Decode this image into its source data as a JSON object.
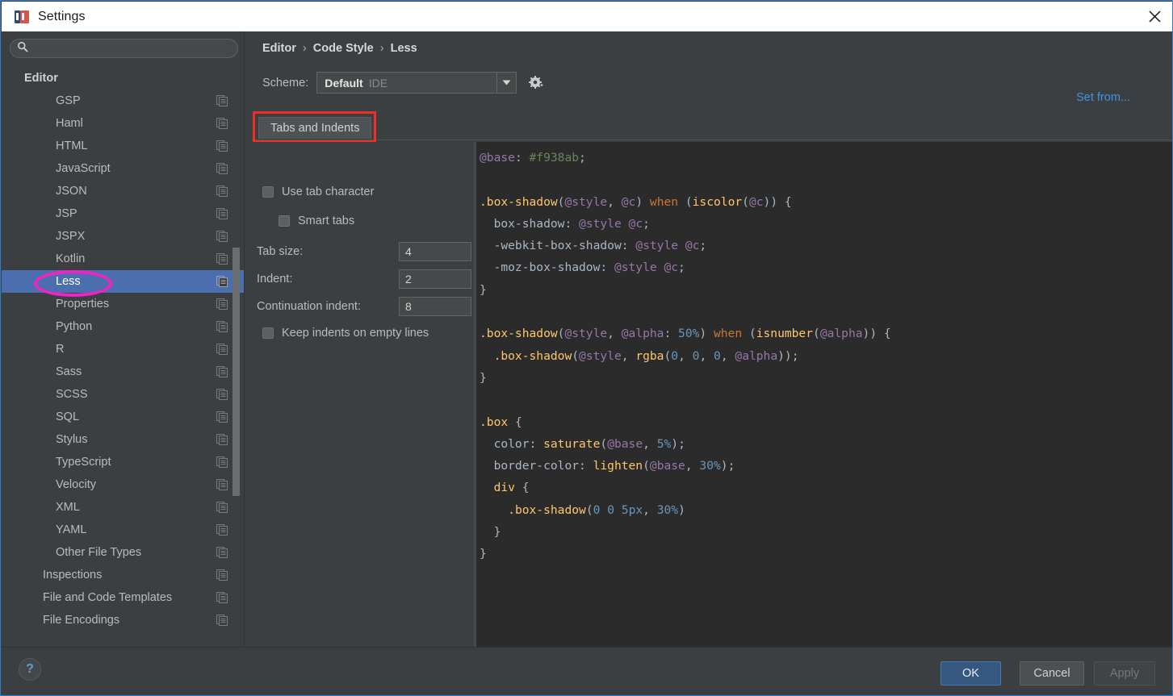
{
  "window": {
    "title": "Settings",
    "app_icon": "intellij-idea-icon",
    "close_icon": "close-icon"
  },
  "sidebar": {
    "search": {
      "value": "",
      "placeholder": "",
      "icon": "search-icon"
    },
    "items": [
      {
        "label": "Editor",
        "level": 0,
        "selected": false,
        "copy_icon": false
      },
      {
        "label": "GSP",
        "level": 2,
        "selected": false,
        "copy_icon": true
      },
      {
        "label": "Haml",
        "level": 2,
        "selected": false,
        "copy_icon": true
      },
      {
        "label": "HTML",
        "level": 2,
        "selected": false,
        "copy_icon": true
      },
      {
        "label": "JavaScript",
        "level": 2,
        "selected": false,
        "copy_icon": true
      },
      {
        "label": "JSON",
        "level": 2,
        "selected": false,
        "copy_icon": true
      },
      {
        "label": "JSP",
        "level": 2,
        "selected": false,
        "copy_icon": true
      },
      {
        "label": "JSPX",
        "level": 2,
        "selected": false,
        "copy_icon": true
      },
      {
        "label": "Kotlin",
        "level": 2,
        "selected": false,
        "copy_icon": true
      },
      {
        "label": "Less",
        "level": 2,
        "selected": true,
        "copy_icon": true
      },
      {
        "label": "Properties",
        "level": 2,
        "selected": false,
        "copy_icon": true
      },
      {
        "label": "Python",
        "level": 2,
        "selected": false,
        "copy_icon": true
      },
      {
        "label": "R",
        "level": 2,
        "selected": false,
        "copy_icon": true
      },
      {
        "label": "Sass",
        "level": 2,
        "selected": false,
        "copy_icon": true
      },
      {
        "label": "SCSS",
        "level": 2,
        "selected": false,
        "copy_icon": true
      },
      {
        "label": "SQL",
        "level": 2,
        "selected": false,
        "copy_icon": true
      },
      {
        "label": "Stylus",
        "level": 2,
        "selected": false,
        "copy_icon": true
      },
      {
        "label": "TypeScript",
        "level": 2,
        "selected": false,
        "copy_icon": true
      },
      {
        "label": "Velocity",
        "level": 2,
        "selected": false,
        "copy_icon": true
      },
      {
        "label": "XML",
        "level": 2,
        "selected": false,
        "copy_icon": true
      },
      {
        "label": "YAML",
        "level": 2,
        "selected": false,
        "copy_icon": true
      },
      {
        "label": "Other File Types",
        "level": 2,
        "selected": false,
        "copy_icon": true
      },
      {
        "label": "Inspections",
        "level": 1,
        "selected": false,
        "copy_icon": true
      },
      {
        "label": "File and Code Templates",
        "level": 1,
        "selected": false,
        "copy_icon": true
      },
      {
        "label": "File Encodings",
        "level": 1,
        "selected": false,
        "copy_icon": true
      }
    ]
  },
  "breadcrumb": {
    "part1": "Editor",
    "part2": "Code Style",
    "part3": "Less",
    "separator": "›"
  },
  "scheme": {
    "label": "Scheme:",
    "value": "Default",
    "scope": "IDE",
    "dropdown_icon": "chevron-down-icon",
    "gear_icon": "gear-icon"
  },
  "set_from_link": "Set from...",
  "tabs": [
    {
      "label": "Tabs and Indents",
      "active": true,
      "annotated": true
    }
  ],
  "options": {
    "use_tab_character": {
      "label": "Use tab character",
      "checked": false
    },
    "smart_tabs": {
      "label": "Smart tabs",
      "checked": false
    },
    "tab_size": {
      "label": "Tab size:",
      "value": "4"
    },
    "indent": {
      "label": "Indent:",
      "value": "2"
    },
    "continuation_indent": {
      "label": "Continuation indent:",
      "value": "8"
    },
    "keep_indents": {
      "label": "Keep indents on empty lines",
      "checked": false
    }
  },
  "preview_code": {
    "language": "Less",
    "lines": [
      "@base: #f938ab;",
      "",
      ".box-shadow(@style, @c) when (iscolor(@c)) {",
      "  box-shadow: @style @c;",
      "  -webkit-box-shadow: @style @c;",
      "  -moz-box-shadow: @style @c;",
      "}",
      "",
      ".box-shadow(@style, @alpha: 50%) when (isnumber(@alpha)) {",
      "  .box-shadow(@style, rgba(0, 0, 0, @alpha));",
      "}",
      "",
      ".box {",
      "  color: saturate(@base, 5%);",
      "  border-color: lighten(@base, 30%);",
      "  div {",
      "    .box-shadow(0 0 5px, 30%)",
      "  }",
      "}"
    ]
  },
  "footer": {
    "help_label": "?",
    "ok_label": "OK",
    "cancel_label": "Cancel",
    "apply_label": "Apply"
  },
  "annotations": {
    "tab_rect_color": "#ee3124",
    "less_ellipse_color": "#ee24c4"
  },
  "colors": {
    "accent_blue": "#4b6eaf",
    "link_blue": "#3d94e3",
    "panel_bg": "#3c3f41",
    "editor_bg": "#2b2b2b"
  }
}
